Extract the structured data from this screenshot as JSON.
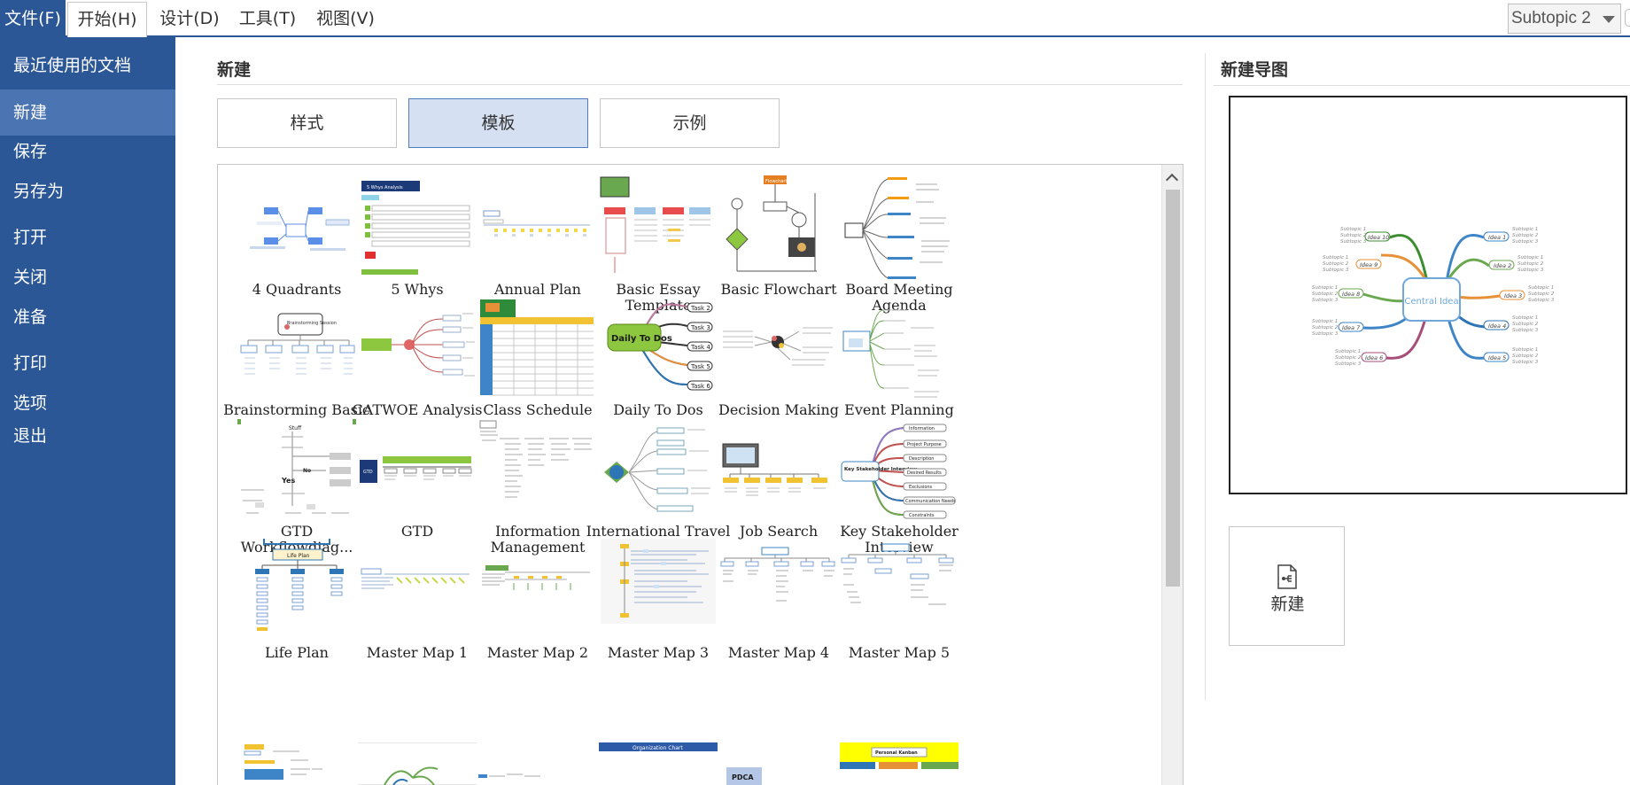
{
  "menubar": {
    "items": [
      "文件(F)",
      "开始(H)",
      "设计(D)",
      "工具(T)",
      "视图(V)"
    ],
    "style_select_value": "Subtopic 2"
  },
  "sidebar": {
    "items": [
      "最近使用的文档",
      "新建",
      "保存",
      "另存为",
      "打开",
      "关闭",
      "准备",
      "打印",
      "选项",
      "退出"
    ],
    "active": "新建"
  },
  "main": {
    "title": "新建",
    "tabs": [
      "样式",
      "模板",
      "示例"
    ],
    "selected_tab": "模板",
    "templates": [
      "4 Quadrants",
      "5 Whys",
      "Annual Plan",
      "Basic Essay Template",
      "Basic Flowchart",
      "Board Meeting Agenda",
      "Brainstorming Basic",
      "CATWOE Analysis",
      "Class Schedule",
      "Daily To Dos",
      "Decision Making",
      "Event Planning",
      "GTD Workflowdiag...",
      "GTD",
      "Information Management",
      "International Travel Plan",
      "Job Search",
      "Key Stakeholder Interview",
      "Life Plan",
      "Master Map 1",
      "Master Map 2",
      "Master Map 3",
      "Master Map 4",
      "Master Map 5"
    ]
  },
  "preview": {
    "title": "新建导图",
    "central": "Central Idea",
    "ideas_left": [
      "Idea 10",
      "Idea 9",
      "Idea 8",
      "Idea 7",
      "Idea 6"
    ],
    "ideas_right": [
      "Idea 1",
      "Idea 2",
      "Idea 3",
      "Idea 4",
      "Idea 5"
    ],
    "subtopics": [
      "Subtopic 1",
      "Subtopic 2",
      "Subtopic 3"
    ],
    "new_button_label": "新建"
  },
  "thumb_text": {
    "flowchart": "Flowchart",
    "daily": "Daily To Dos",
    "tasks": [
      "Task 2",
      "Task 3",
      "Task 4",
      "Task 5",
      "Task 6"
    ],
    "key_stakeholder": "Key Stakeholder Interview",
    "ks_items": [
      "Information",
      "Project Purpose",
      "Description",
      "Desired Results",
      "Exclusions",
      "Communication Needs",
      "Constraints"
    ],
    "life_plan": "Life Plan",
    "org_chart": "Organization Chart",
    "pdca": "PDCA",
    "personal_goals": "Personal Kanban",
    "yes": "Yes",
    "no": "No",
    "stuff": "Stuff",
    "gtd": "GTD",
    "five_whys": "5 Whys Analysis",
    "brainstorm": "Brainstorming Session",
    "class_schedule": "Class Schedule"
  },
  "colors": {
    "accent": "#2b5797",
    "sidebar_active": "#4a74b2",
    "tab_selected": "#d5e1f2"
  }
}
